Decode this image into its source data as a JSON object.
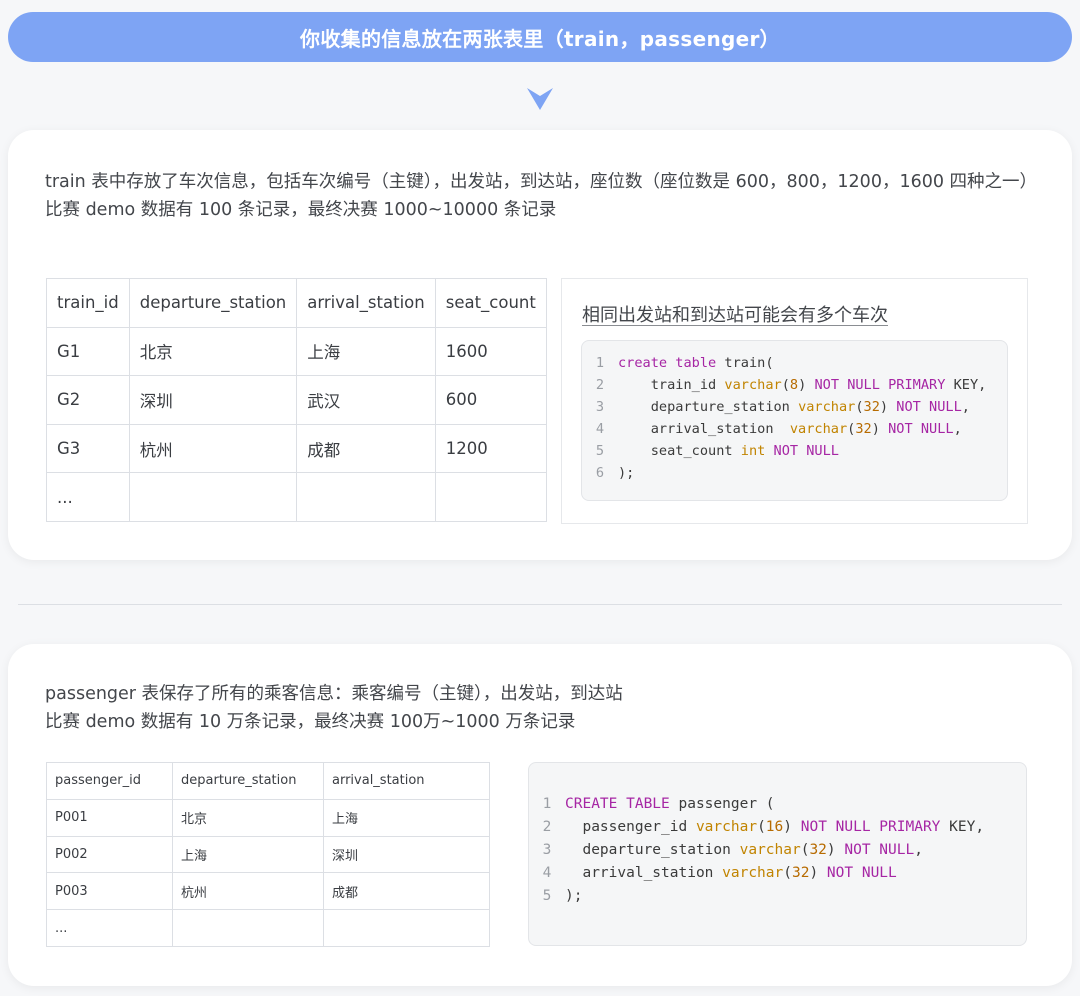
{
  "banner": {
    "text": "你收集的信息放在两张表里（train，passenger）"
  },
  "colors": {
    "banner": "#7ea4f4",
    "keyword": "#a626a4",
    "type": "#c18401",
    "number": "#b76b01"
  },
  "train": {
    "desc": [
      "train 表中存放了车次信息，包括车次编号（主键），出发站，到达站，座位数（座位数是 600，800，1200，1600 四种之一）",
      "比赛 demo 数据有 100 条记录，最终决赛 1000~10000 条记录"
    ],
    "table": {
      "headers": [
        "train_id",
        "departure_station",
        "arrival_station",
        "seat_count"
      ],
      "rows": [
        [
          "G1",
          "北京",
          "上海",
          "1600"
        ],
        [
          "G2",
          "深圳",
          "武汉",
          "600"
        ],
        [
          "G3",
          "杭州",
          "成都",
          "1200"
        ],
        [
          "...",
          "",
          "",
          ""
        ]
      ]
    },
    "note": "相同出发站和到达站可能会有多个车次",
    "code": [
      {
        "n": "1",
        "tokens": [
          [
            "kw",
            "create table"
          ],
          [
            "",
            " train("
          ]
        ]
      },
      {
        "n": "2",
        "tokens": [
          [
            "",
            "    train_id "
          ],
          [
            "ty",
            "varchar"
          ],
          [
            "",
            "("
          ],
          [
            "nu",
            "8"
          ],
          [
            "",
            ") "
          ],
          [
            "kw",
            "NOT NULL PRIMARY"
          ],
          [
            "",
            " KEY,"
          ]
        ]
      },
      {
        "n": "3",
        "tokens": [
          [
            "",
            "    departure_station "
          ],
          [
            "ty",
            "varchar"
          ],
          [
            "",
            "("
          ],
          [
            "nu",
            "32"
          ],
          [
            "",
            ") "
          ],
          [
            "kw",
            "NOT NULL"
          ],
          [
            "",
            ","
          ]
        ]
      },
      {
        "n": "4",
        "tokens": [
          [
            "",
            "    arrival_station  "
          ],
          [
            "ty",
            "varchar"
          ],
          [
            "",
            "("
          ],
          [
            "nu",
            "32"
          ],
          [
            "",
            ") "
          ],
          [
            "kw",
            "NOT NULL"
          ],
          [
            "",
            ","
          ]
        ]
      },
      {
        "n": "5",
        "tokens": [
          [
            "",
            "    seat_count "
          ],
          [
            "ty",
            "int"
          ],
          [
            "",
            " "
          ],
          [
            "kw",
            "NOT NULL"
          ]
        ]
      },
      {
        "n": "6",
        "tokens": [
          [
            "",
            ");"
          ]
        ]
      }
    ]
  },
  "passenger": {
    "desc": [
      "passenger 表保存了所有的乘客信息：乘客编号（主键），出发站，到达站",
      "比赛 demo 数据有 10 万条记录，最终决赛 100万~1000 万条记录"
    ],
    "table": {
      "headers": [
        "passenger_id",
        "departure_station",
        "arrival_station"
      ],
      "rows": [
        [
          "P001",
          "北京",
          "上海"
        ],
        [
          "P002",
          "上海",
          "深圳"
        ],
        [
          "P003",
          "杭州",
          "成都"
        ],
        [
          "...",
          "",
          ""
        ]
      ]
    },
    "code": [
      {
        "n": "1",
        "tokens": [
          [
            "kw",
            "CREATE TABLE"
          ],
          [
            "",
            " passenger ("
          ]
        ]
      },
      {
        "n": "2",
        "tokens": [
          [
            "",
            "  passenger_id "
          ],
          [
            "ty",
            "varchar"
          ],
          [
            "",
            "("
          ],
          [
            "nu",
            "16"
          ],
          [
            "",
            ") "
          ],
          [
            "kw",
            "NOT NULL PRIMARY"
          ],
          [
            "",
            " KEY,"
          ]
        ]
      },
      {
        "n": "3",
        "tokens": [
          [
            "",
            "  departure_station "
          ],
          [
            "ty",
            "varchar"
          ],
          [
            "",
            "("
          ],
          [
            "nu",
            "32"
          ],
          [
            "",
            ") "
          ],
          [
            "kw",
            "NOT NULL"
          ],
          [
            "",
            ","
          ]
        ]
      },
      {
        "n": "4",
        "tokens": [
          [
            "",
            "  arrival_station "
          ],
          [
            "ty",
            "varchar"
          ],
          [
            "",
            "("
          ],
          [
            "nu",
            "32"
          ],
          [
            "",
            ") "
          ],
          [
            "kw",
            "NOT NULL"
          ]
        ]
      },
      {
        "n": "5",
        "tokens": [
          [
            "",
            ");"
          ]
        ]
      }
    ]
  }
}
